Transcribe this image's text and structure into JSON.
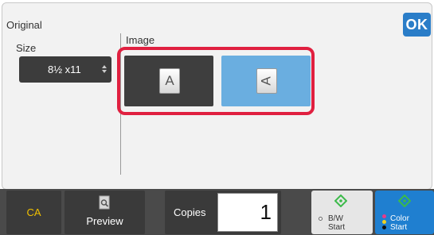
{
  "header": {
    "title": "Original",
    "ok_label": "OK"
  },
  "size": {
    "label": "Size",
    "value": "8½ x11"
  },
  "image": {
    "label": "Image",
    "options": [
      {
        "glyph": "A",
        "selected": true
      },
      {
        "glyph": "A",
        "selected": false
      }
    ]
  },
  "footer": {
    "ca_label": "CA",
    "preview_label": "Preview",
    "copies_label": "Copies",
    "copies_value": "1",
    "bw_line1": "B/W",
    "bw_line2": "Start",
    "color_line1": "Color",
    "color_line2": "Start"
  },
  "colors": {
    "accent": "#2a7dc8",
    "highlight": "#e02040",
    "ca_text": "#f0c000",
    "start_green": "#3cba4a"
  }
}
